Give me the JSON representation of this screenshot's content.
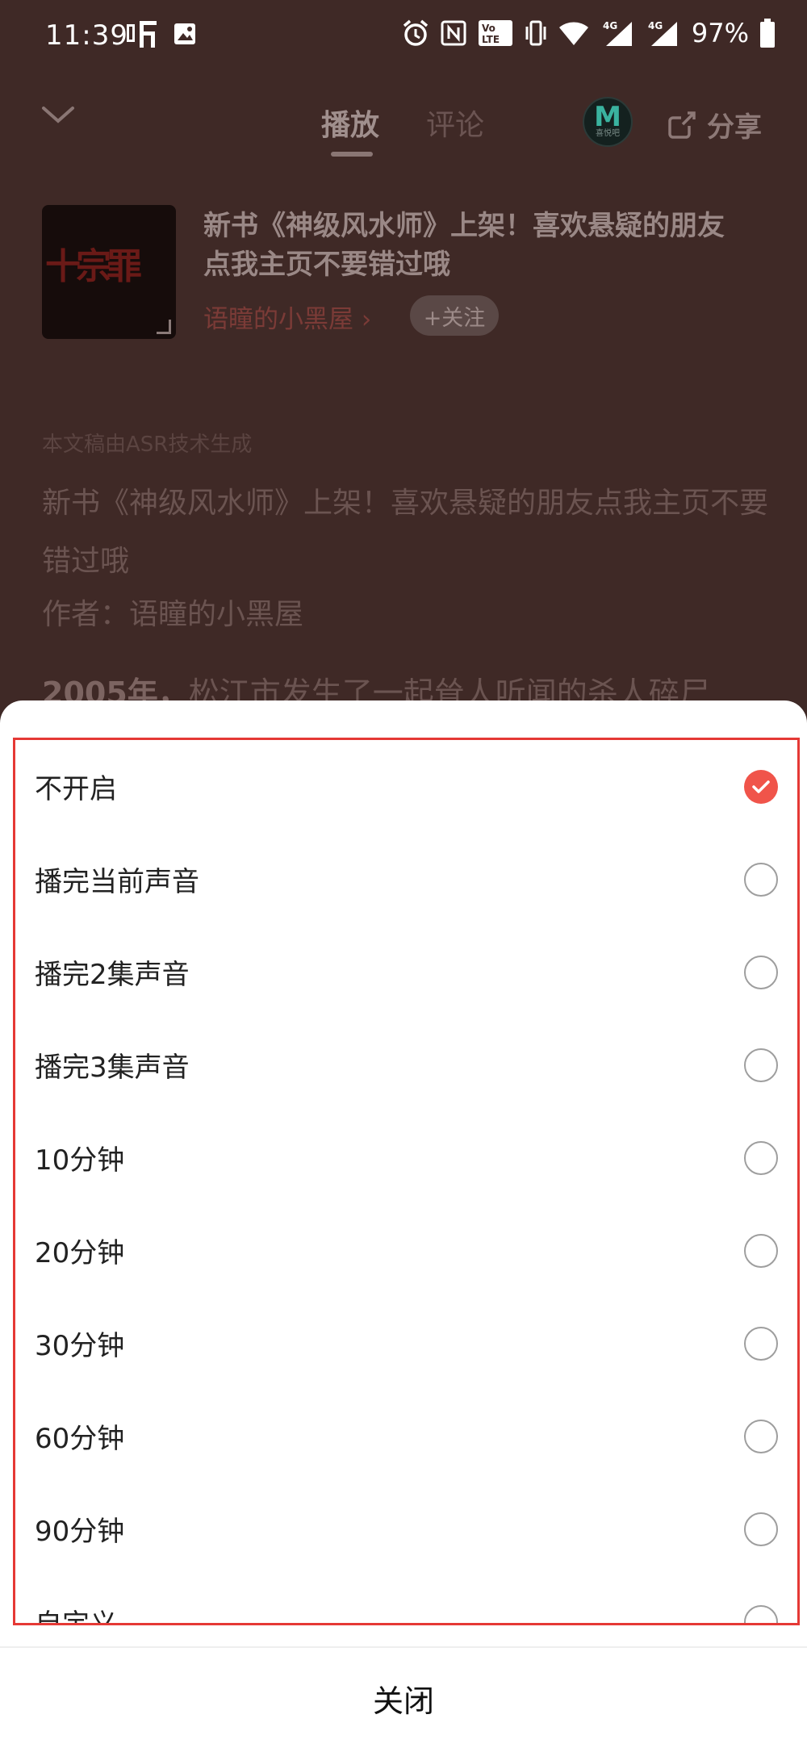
{
  "status_bar": {
    "time": "11:39",
    "battery": "97%",
    "network_1": "4G",
    "network_2": "4G",
    "volte": "Vo LTE"
  },
  "nav": {
    "tab_play": "播放",
    "tab_comment": "评论",
    "logo_letter": "M",
    "logo_sub": "喜悦吧",
    "share_label": "分享"
  },
  "track": {
    "title": "新书《神级风水师》上架！喜欢悬疑的朋友点我主页不要错过哦",
    "author": "语瞳的小黑屋",
    "follow_label": "+关注",
    "album_text": "十宗罪"
  },
  "content": {
    "asr_note": "本文稿由ASR技术生成",
    "paragraph": "新书《神级风水师》上架！喜欢悬疑的朋友点我主页不要错过哦",
    "author_line": "作者：语瞳的小黑屋",
    "story_year": "2005年，",
    "story_rest": "松江市发生了一起耸人听闻的杀人碎尸"
  },
  "sheet": {
    "options": [
      {
        "label": "不开启",
        "selected": true
      },
      {
        "label": "播完当前声音",
        "selected": false
      },
      {
        "label": "播完2集声音",
        "selected": false
      },
      {
        "label": "播完3集声音",
        "selected": false
      },
      {
        "label": "10分钟",
        "selected": false
      },
      {
        "label": "20分钟",
        "selected": false
      },
      {
        "label": "30分钟",
        "selected": false
      },
      {
        "label": "60分钟",
        "selected": false
      },
      {
        "label": "90分钟",
        "selected": false
      },
      {
        "label": "自定义",
        "selected": false
      }
    ],
    "close_label": "关闭"
  },
  "colors": {
    "accent": "#f0544a",
    "highlight_border": "#e53935",
    "overlay_bg": "#3f2926"
  }
}
